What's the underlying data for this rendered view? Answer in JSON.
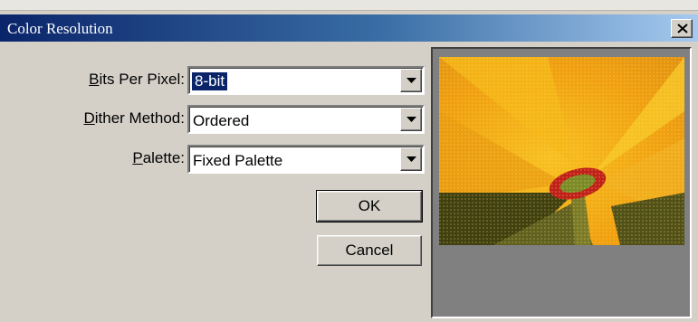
{
  "dialog": {
    "title": "Color Resolution",
    "close_glyph": "×"
  },
  "fields": {
    "bits_per_pixel": {
      "label_mnemonic": "B",
      "label_rest": "its Per Pixel:",
      "value": "8-bit"
    },
    "dither_method": {
      "label_mnemonic": "D",
      "label_rest": "ither Method:",
      "value": "Ordered"
    },
    "palette": {
      "label_mnemonic": "P",
      "label_rest": "alette:",
      "value": "Fixed Palette"
    }
  },
  "buttons": {
    "ok": "OK",
    "cancel": "Cancel"
  },
  "icons": {
    "close": "close-icon",
    "dropdown": "chevron-down-icon"
  },
  "colors": {
    "selection": "#0a246a",
    "title_gradient_start": "#0a246a",
    "title_gradient_end": "#a6caf0",
    "preview_background": "#808080"
  }
}
